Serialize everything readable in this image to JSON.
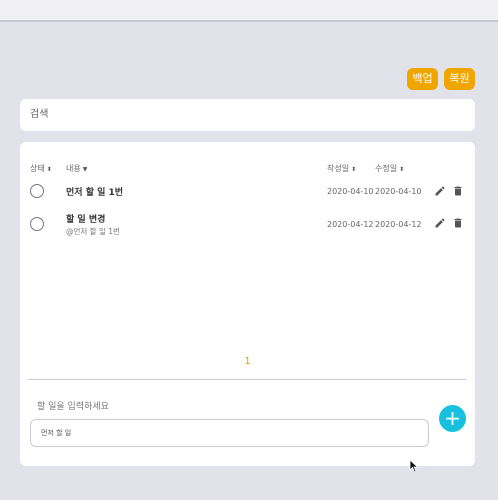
{
  "toolbar": {
    "backup_label": "백업",
    "restore_label": "복원"
  },
  "search": {
    "placeholder": "검색"
  },
  "table": {
    "headers": {
      "status": "상태",
      "content": "내용",
      "created": "작성일",
      "modified": "수정일"
    },
    "rows": [
      {
        "title": "먼저 할 일 1번",
        "sub": "",
        "created": "2020-04-10",
        "modified": "2020-04-10"
      },
      {
        "title": "할 일 변경",
        "sub": "@먼저 할 일 1번",
        "created": "2020-04-12",
        "modified": "2020-04-12"
      }
    ]
  },
  "pagination": {
    "current": "1"
  },
  "new_todo": {
    "label": "할 일을 입력하세요",
    "value": "먼저 할 일"
  },
  "colors": {
    "accent": "#f0a500",
    "add_button": "#18c0e0",
    "page_number": "#e0a000"
  }
}
